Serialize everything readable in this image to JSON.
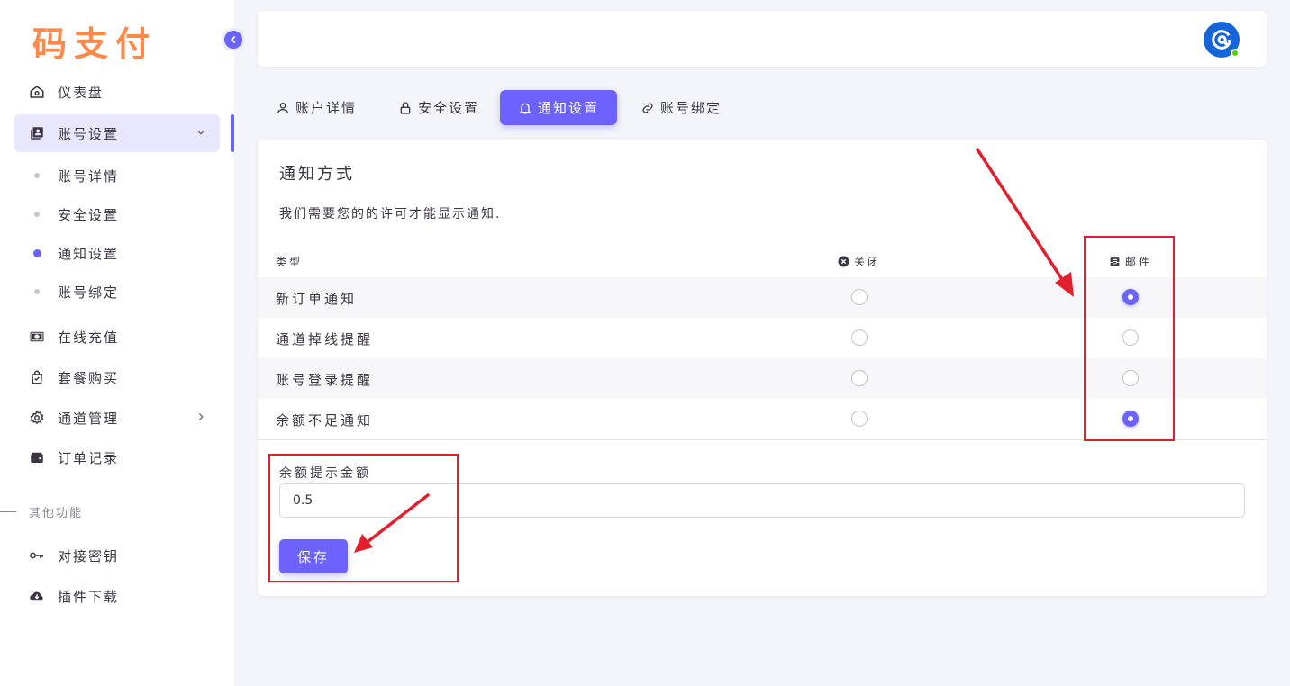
{
  "sidebar": {
    "logo": "码支付",
    "items": [
      {
        "label": "仪表盘",
        "icon": "home-icon"
      },
      {
        "label": "账号设置",
        "icon": "account-box-icon",
        "expanded": true
      },
      {
        "label": "在线充值",
        "icon": "cash-icon"
      },
      {
        "label": "套餐购买",
        "icon": "shopping-bag-icon"
      },
      {
        "label": "通道管理",
        "icon": "gear-icon"
      },
      {
        "label": "订单记录",
        "icon": "wallet-icon"
      }
    ],
    "sub_items": [
      {
        "label": "账号详情"
      },
      {
        "label": "安全设置"
      },
      {
        "label": "通知设置",
        "active": true
      },
      {
        "label": "账号绑定"
      }
    ],
    "section_label": "其他功能",
    "other_items": [
      {
        "label": "对接密钥",
        "icon": "key-icon"
      },
      {
        "label": "插件下载",
        "icon": "cloud-download-icon"
      }
    ]
  },
  "tabs": [
    {
      "label": "账户详情",
      "icon": "user-icon"
    },
    {
      "label": "安全设置",
      "icon": "lock-icon"
    },
    {
      "label": "通知设置",
      "icon": "bell-icon",
      "active": true
    },
    {
      "label": "账号绑定",
      "icon": "link-icon"
    }
  ],
  "card": {
    "title": "通知方式",
    "description": "我们需要您的的许可才能显示通知.",
    "columns": {
      "type": "类型",
      "off": "关闭",
      "email": "邮件"
    },
    "rows": [
      {
        "label": "新订单通知",
        "off": false,
        "email": true
      },
      {
        "label": "通道掉线提醒",
        "off": false,
        "email": false
      },
      {
        "label": "账号登录提醒",
        "off": false,
        "email": false
      },
      {
        "label": "余额不足通知",
        "off": false,
        "email": true
      }
    ],
    "field_label": "余额提示金额",
    "field_value": "0.5",
    "save_label": "保存"
  },
  "colors": {
    "primary": "#6c63ff",
    "logo": "#ff8a4a",
    "annotation": "#e0202e"
  }
}
